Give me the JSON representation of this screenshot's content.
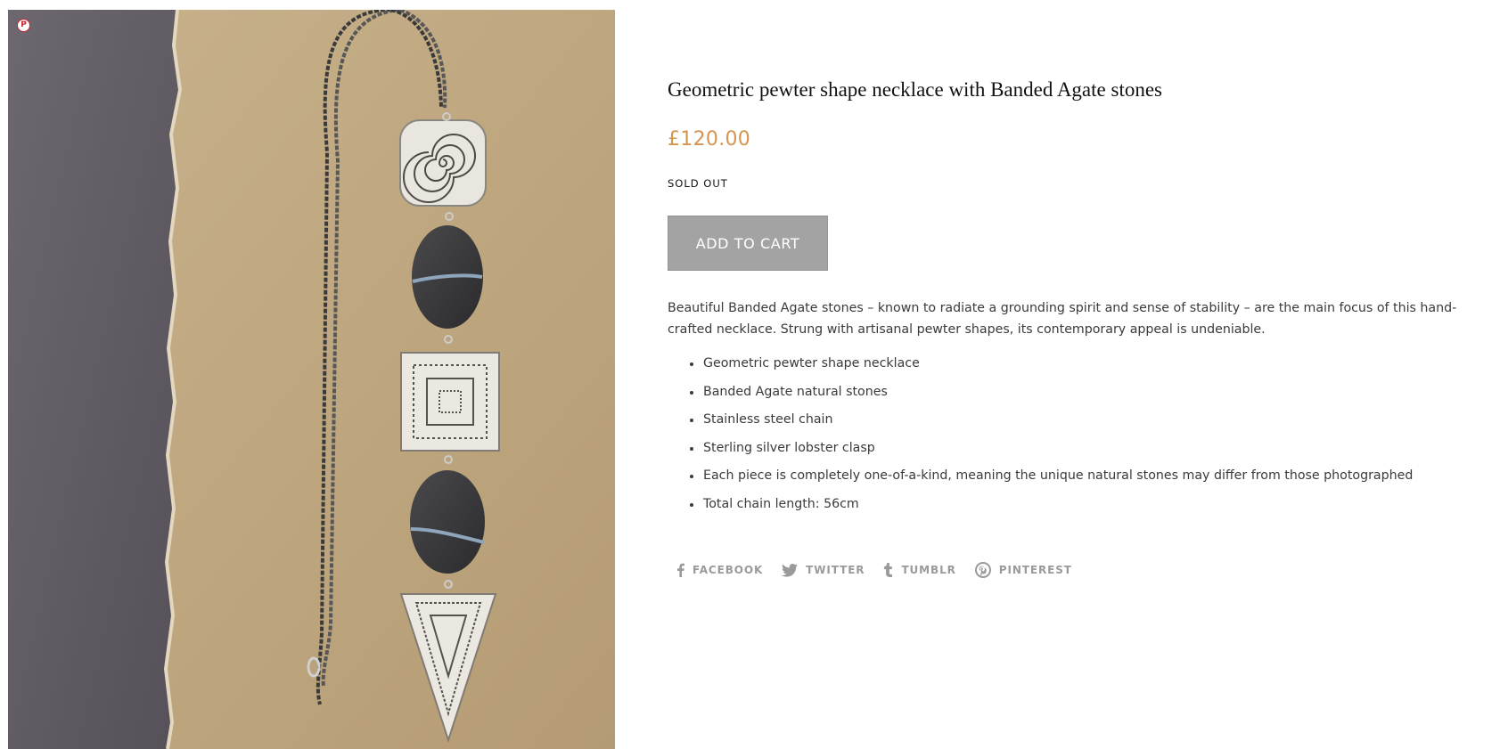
{
  "product": {
    "title": "Geometric pewter shape necklace with Banded Agate stones",
    "price": "£120.00",
    "availability": "SOLD OUT",
    "add_to_cart_label": "ADD TO CART",
    "image_alt": "Geometric pewter shape necklace with Banded Agate stones",
    "pin_badge_glyph": "P",
    "description": "Beautiful Banded Agate stones – known to radiate a grounding spirit and sense of stability – are the main focus of this hand-crafted necklace. Strung with artisanal pewter shapes, its contemporary appeal is undeniable.",
    "features": [
      "Geometric pewter shape necklace",
      "Banded Agate natural stones",
      "Stainless steel chain",
      "Sterling silver lobster clasp",
      "Each piece is completely one-of-a-kind, meaning the unique natural stones may differ from those photographed",
      "Total chain length: 56cm"
    ]
  },
  "share": {
    "facebook": "FACEBOOK",
    "twitter": "TWITTER",
    "tumblr": "TUMBLR",
    "pinterest": "PINTEREST"
  },
  "icons": {
    "pin_badge": "pinterest-icon",
    "facebook": "facebook-icon",
    "twitter": "twitter-icon",
    "tumblr": "tumblr-icon",
    "pinterest": "pinterest-icon"
  },
  "colors": {
    "price": "#d4954f",
    "button_bg": "#a3a3a3",
    "share_text": "#9a9a9a",
    "pin_badge": "#c8232c"
  }
}
